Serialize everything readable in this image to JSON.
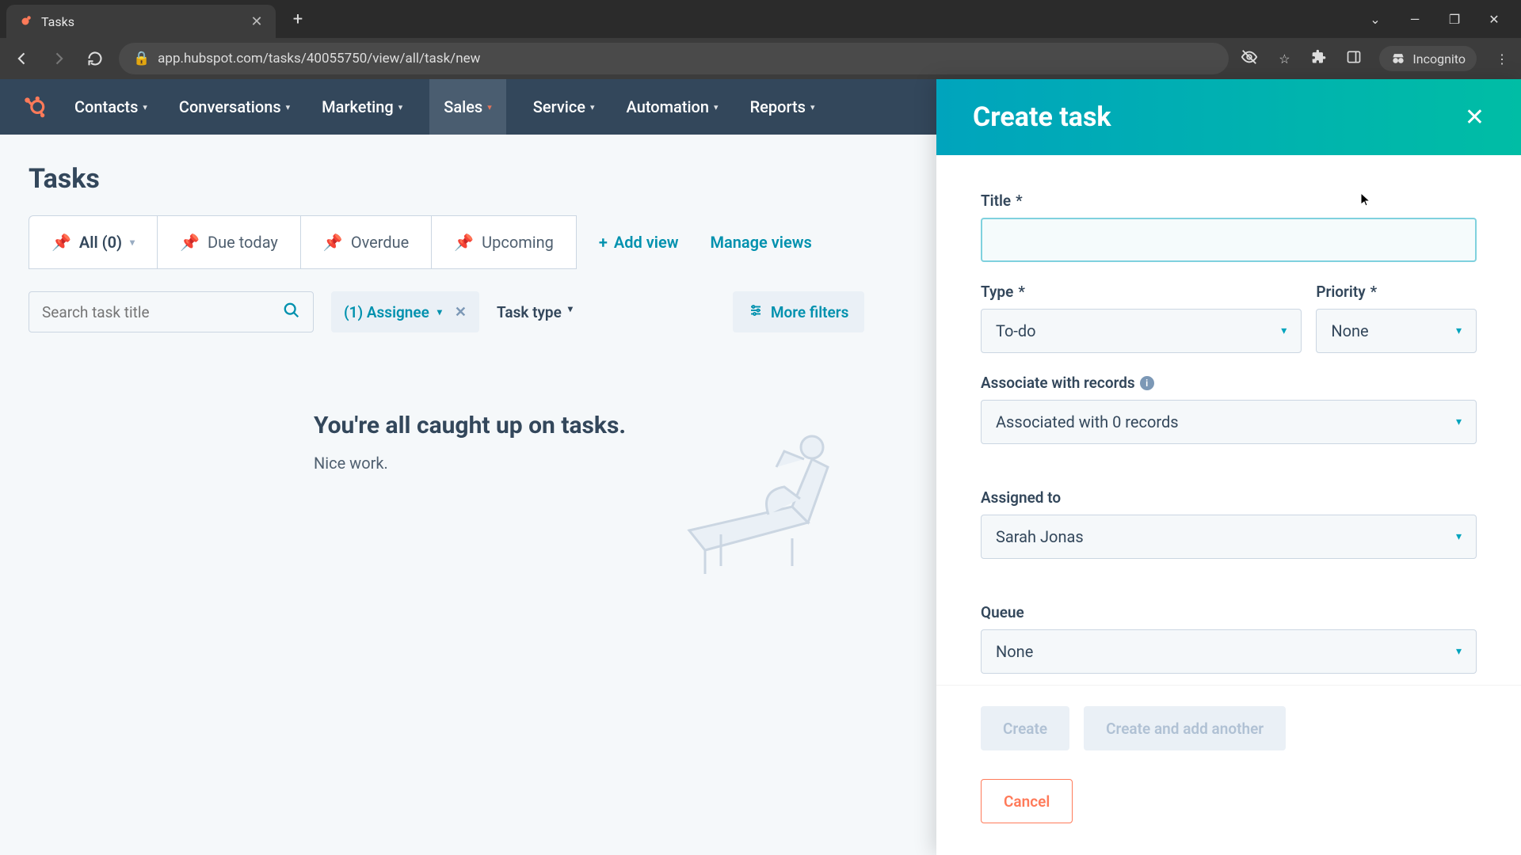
{
  "browser": {
    "tab_title": "Tasks",
    "url": "app.hubspot.com/tasks/40055750/view/all/task/new",
    "incognito_label": "Incognito"
  },
  "nav": {
    "items": [
      "Contacts",
      "Conversations",
      "Marketing",
      "Sales",
      "Service",
      "Automation",
      "Reports"
    ],
    "active_index": 3
  },
  "page": {
    "title": "Tasks",
    "tabs": {
      "all": "All (0)",
      "due_today": "Due today",
      "overdue": "Overdue",
      "upcoming": "Upcoming"
    },
    "add_view": "Add view",
    "manage_views": "Manage views",
    "search_placeholder": "Search task title",
    "assignee_chip": "(1) Assignee",
    "task_type_label": "Task type",
    "more_filters": "More filters",
    "empty_heading": "You're all caught up on tasks.",
    "empty_sub": "Nice work."
  },
  "panel": {
    "title": "Create task",
    "labels": {
      "title": "Title",
      "type": "Type",
      "priority": "Priority",
      "associate": "Associate with records",
      "assigned": "Assigned to",
      "queue": "Queue"
    },
    "values": {
      "title": "",
      "type": "To-do",
      "priority": "None",
      "associate": "Associated with 0 records",
      "assigned": "Sarah Jonas",
      "queue": "None"
    },
    "buttons": {
      "create": "Create",
      "create_another": "Create and add another",
      "cancel": "Cancel"
    }
  },
  "colors": {
    "accent_teal": "#00a4bd",
    "accent_orange": "#ff7a59",
    "nav_bg": "#33475b"
  }
}
